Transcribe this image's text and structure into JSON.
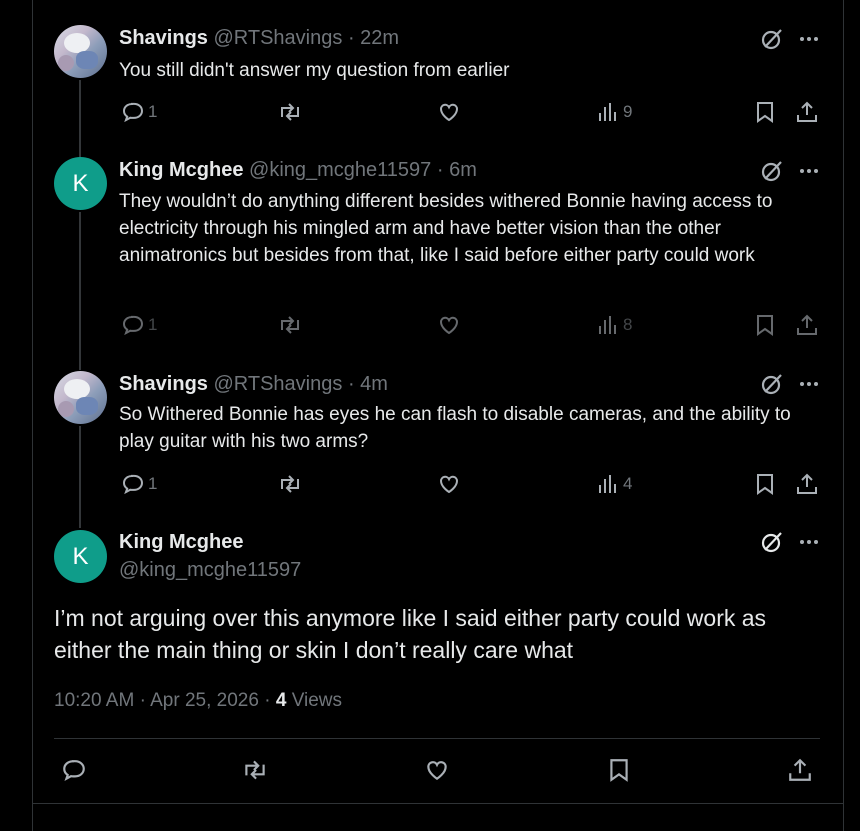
{
  "replies": [
    {
      "name": "Shavings",
      "handle": "@RTShavings",
      "sep": "·",
      "time": "22m",
      "text": "You still didn't answer my question from earlier",
      "reply_count": "1",
      "views": "9",
      "avatar": "photo"
    },
    {
      "name": "King Mcghee",
      "handle": "@king_mcghe11597",
      "sep": "·",
      "time": "6m",
      "text": "They wouldn’t do anything different besides withered Bonnie having access to electricity through his mingled arm and have better vision than the other animatronics but besides from that, like I said before either party could work",
      "reply_count": "1",
      "views": "8",
      "avatar": "K"
    },
    {
      "name": "Shavings",
      "handle": "@RTShavings",
      "sep": "·",
      "time": "4m",
      "text": "So Withered Bonnie has eyes he can flash to disable cameras, and the ability to play guitar with his two arms?",
      "reply_count": "1",
      "views": "4",
      "avatar": "photo"
    }
  ],
  "main_post": {
    "name": "King Mcghee",
    "handle": "@king_mcghe11597",
    "avatar": "K",
    "text": "I’m not arguing over this anymore like I said either party could work as either the main thing or skin I don’t really care what",
    "time": "10:20 AM",
    "date": "Apr 25, 2026",
    "views_count": "4",
    "views_label": "Views",
    "sep": "·"
  },
  "icons": [
    "grok-icon",
    "more-icon",
    "reply-icon",
    "repost-icon",
    "like-icon",
    "views-icon",
    "bookmark-icon",
    "share-icon"
  ],
  "colors": {
    "background": "#000000",
    "text": "#e7e9ea",
    "muted": "#71767b",
    "avatar_k": "#0f9d8a",
    "border": "#2f3336"
  }
}
